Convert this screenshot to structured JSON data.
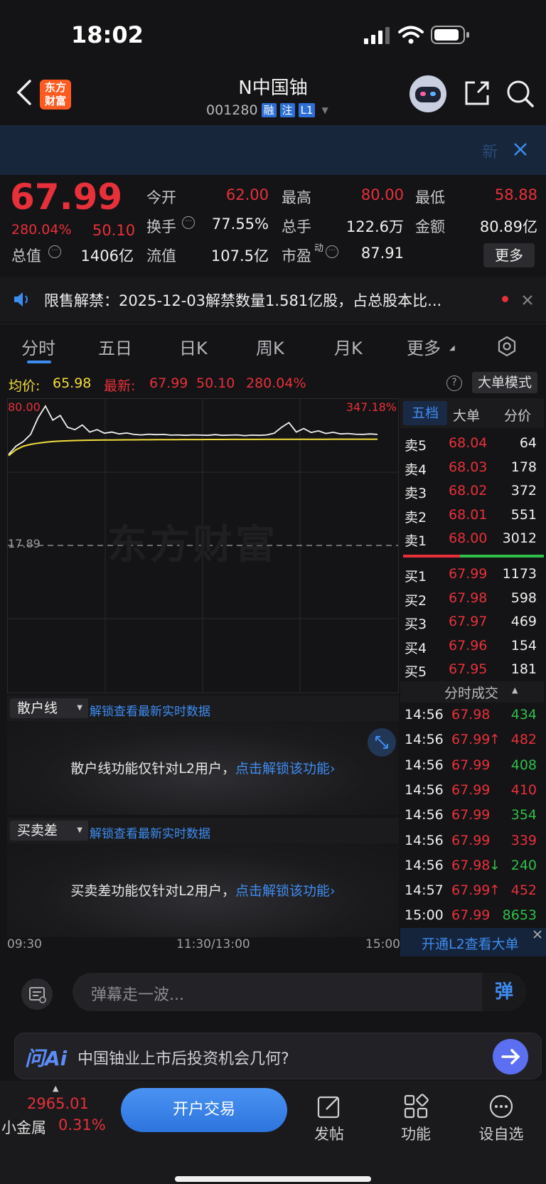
{
  "status": {
    "time": "18:02"
  },
  "header": {
    "title": "N中国铀",
    "code": "001280",
    "tags": [
      "融",
      "注",
      "L1"
    ],
    "logo_line1": "东方",
    "logo_line2": "财富",
    "banner_text": "新"
  },
  "quote": {
    "price": "67.99",
    "pct": "280.04%",
    "change": "50.10",
    "fields": [
      {
        "label": "今开",
        "value": "62.00"
      },
      {
        "label": "最高",
        "value": "80.00"
      },
      {
        "label": "最低",
        "value": "58.88"
      },
      {
        "label": "换手",
        "value": "77.55%"
      },
      {
        "label": "总手",
        "value": "122.6万"
      },
      {
        "label": "金额",
        "value": "80.89亿"
      },
      {
        "label": "总值",
        "value": "1406亿"
      },
      {
        "label": "流值",
        "value": "107.5亿"
      },
      {
        "label": "市盈",
        "value": "87.91"
      }
    ],
    "pe_sup": "动",
    "more": "更多"
  },
  "notice": {
    "text": "限售解禁：2025-12-03解禁数量1.581亿股，占总股本比..."
  },
  "tabs": [
    "分时",
    "五日",
    "日K",
    "周K",
    "月K",
    "更多"
  ],
  "info": {
    "avg_label": "均价:",
    "avg": "65.98",
    "latest_label": "最新:",
    "latest": "67.99",
    "change": "50.10",
    "pct": "280.04%",
    "big_mode": "大单模式",
    "help": "?"
  },
  "chart": {
    "top_label": "80.00",
    "top_pct": "347.18%",
    "mid_label": "17.89",
    "watermark": "东方财富"
  },
  "chart_data": {
    "type": "line",
    "series": [
      {
        "values": [
          59.5,
          63,
          65,
          68,
          75,
          80,
          74,
          76,
          71,
          70,
          72,
          69,
          70,
          68.5,
          69,
          68.2,
          68.6,
          68,
          67.8,
          68.1,
          67.9,
          68,
          67.7,
          67.8,
          67.6,
          67.8,
          67.7,
          67.6,
          67.9,
          67.6,
          67.7,
          67.8,
          67.5,
          67.7,
          67.6,
          67.8,
          68.5,
          71,
          73,
          69,
          70.5,
          68.8,
          69.5,
          68.4,
          68.9,
          68.2,
          68.4,
          68.1,
          68,
          68.2,
          67.99
        ]
      },
      {
        "values": [
          59,
          61.5,
          63,
          63.8,
          64.3,
          64.7,
          65,
          65.2,
          65.3,
          65.4,
          65.5,
          65.55,
          65.6,
          65.62,
          65.65,
          65.68,
          65.7,
          65.72,
          65.74,
          65.75,
          65.77,
          65.78,
          65.79,
          65.8,
          65.82,
          65.83,
          65.84,
          65.85,
          65.86,
          65.87,
          65.88,
          65.88,
          65.89,
          65.9,
          65.9,
          65.91,
          65.92,
          65.93,
          65.94,
          65.94,
          65.95,
          65.95,
          65.96,
          65.96,
          65.97,
          65.97,
          65.97,
          65.98,
          65.98,
          65.98,
          65.98
        ]
      }
    ],
    "ylim": [
      17.89,
      80.0
    ]
  },
  "orderbook": {
    "tabs": [
      "五档",
      "大单",
      "分价"
    ],
    "asks": [
      {
        "label": "卖5",
        "price": "68.04",
        "vol": "64"
      },
      {
        "label": "卖4",
        "price": "68.03",
        "vol": "178"
      },
      {
        "label": "卖3",
        "price": "68.02",
        "vol": "372"
      },
      {
        "label": "卖2",
        "price": "68.01",
        "vol": "551"
      },
      {
        "label": "卖1",
        "price": "68.00",
        "vol": "3012"
      }
    ],
    "bids": [
      {
        "label": "买1",
        "price": "67.99",
        "vol": "1173"
      },
      {
        "label": "买2",
        "price": "67.98",
        "vol": "598"
      },
      {
        "label": "买3",
        "price": "67.97",
        "vol": "469"
      },
      {
        "label": "买4",
        "price": "67.96",
        "vol": "154"
      },
      {
        "label": "买5",
        "price": "67.95",
        "vol": "181"
      }
    ],
    "trades_title": "分时成交",
    "trades": [
      {
        "t": "14:56",
        "p": "67.98",
        "arrow": "",
        "v": "434",
        "c": "green"
      },
      {
        "t": "14:56",
        "p": "67.99",
        "arrow": "↑",
        "v": "482",
        "c": "red"
      },
      {
        "t": "14:56",
        "p": "67.99",
        "arrow": "",
        "v": "408",
        "c": "green"
      },
      {
        "t": "14:56",
        "p": "67.99",
        "arrow": "",
        "v": "410",
        "c": "red"
      },
      {
        "t": "14:56",
        "p": "67.99",
        "arrow": "",
        "v": "354",
        "c": "green"
      },
      {
        "t": "14:56",
        "p": "67.99",
        "arrow": "",
        "v": "339",
        "c": "red"
      },
      {
        "t": "14:56",
        "p": "67.98",
        "arrow": "↓",
        "v": "240",
        "c": "green"
      },
      {
        "t": "14:57",
        "p": "67.99",
        "arrow": "↑",
        "v": "452",
        "c": "red"
      },
      {
        "t": "15:00",
        "p": "67.99",
        "arrow": "",
        "v": "8653",
        "c": "green"
      }
    ],
    "l2_cta": "开通L2查看大单"
  },
  "panels": [
    {
      "select": "散户线",
      "unlock": "解锁查看最新实时数据",
      "text": "散户线功能仅针对L2用户，",
      "link": "点击解锁该功能"
    },
    {
      "select": "买卖差",
      "unlock": "解锁查看最新实时数据",
      "text": "买卖差功能仅针对L2用户，",
      "link": "点击解锁该功能"
    }
  ],
  "timeaxis": [
    "09:30",
    "11:30/13:00",
    "15:00"
  ],
  "danmu": {
    "placeholder": "弹幕走一波...",
    "send": "弹"
  },
  "ai": {
    "logo": "问Ai",
    "question": "中国铀业上市后投资机会几何?"
  },
  "bottom": {
    "index_value": "2965.01",
    "index_name": "小金属",
    "index_pct": "0.31%",
    "trade_btn": "开户交易",
    "post": "发帖",
    "func": "功能",
    "watch": "设自选"
  }
}
